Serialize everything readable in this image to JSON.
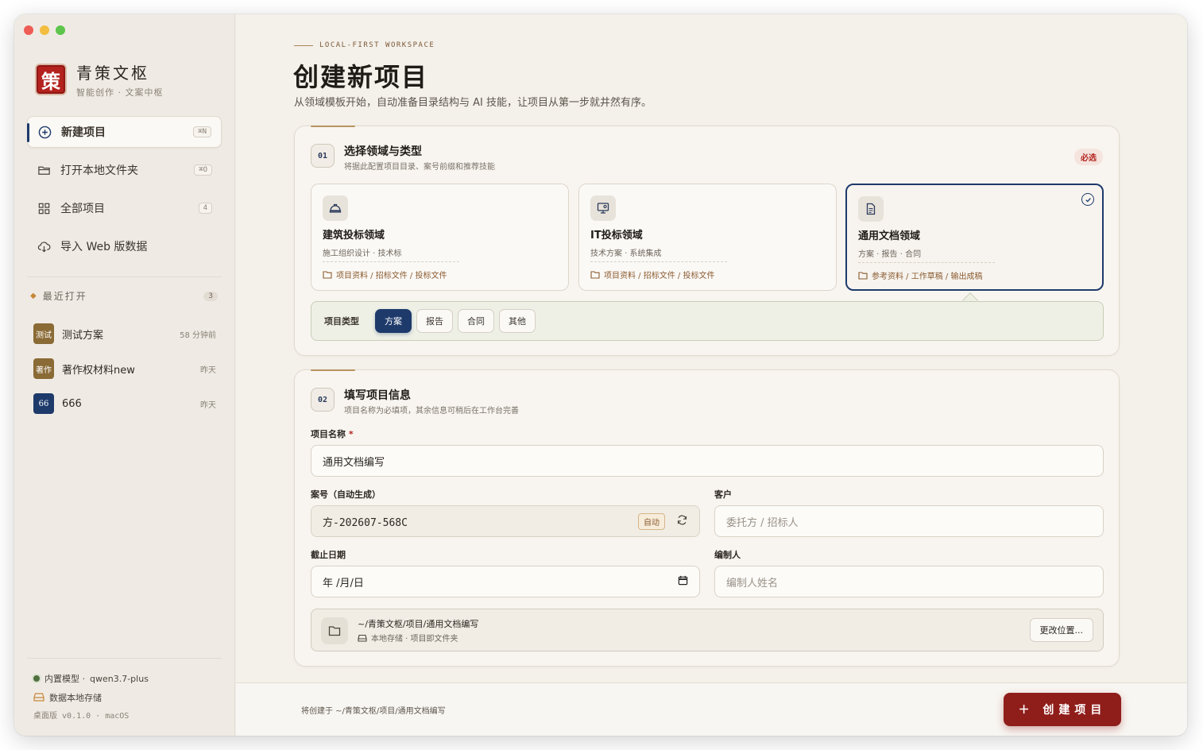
{
  "brand": {
    "seal_char": "策",
    "title": "青策文枢",
    "subtitle": "智能创作 · 文案中枢"
  },
  "nav": [
    {
      "label": "新建项目",
      "shortcut": "⌘N",
      "active": true
    },
    {
      "label": "打开本地文件夹",
      "shortcut": "⌘O"
    },
    {
      "label": "全部项目",
      "count": "4"
    },
    {
      "label": "导入 Web 版数据"
    }
  ],
  "recent": {
    "heading": "最近打开",
    "count": "3",
    "items": [
      {
        "badge": "测试",
        "name": "测试方案",
        "time": "58 分钟前",
        "color": "#8a6a35"
      },
      {
        "badge": "著作",
        "name": "著作权材料new",
        "time": "昨天",
        "color": "#8a6a35"
      },
      {
        "badge": "66",
        "name": "666",
        "time": "昨天",
        "color": "#1e3a6b"
      }
    ]
  },
  "footer": {
    "model_label": "内置模型 ·",
    "model_name": "qwen3.7-plus",
    "storage": "数据本地存储",
    "version": "桌面版 v0.1.0 · macOS"
  },
  "header": {
    "eyebrow": "LOCAL-FIRST WORKSPACE",
    "title": "创建新项目",
    "subtitle": "从领域模板开始，自动准备目录结构与 AI 技能，让项目从第一步就井然有序。"
  },
  "step1": {
    "num": "01",
    "title": "选择领域与类型",
    "desc": "将据此配置项目目录、案号前缀和推荐技能",
    "required": "必选",
    "domains": [
      {
        "name": "建筑投标领域",
        "tags": "施工组织设计 · 技术标",
        "folders": "项目资料 / 招标文件 / 投标文件",
        "icon": "helmet-icon"
      },
      {
        "name": "IT投标领域",
        "tags": "技术方案 · 系统集成",
        "folders": "项目资料 / 招标文件 / 投标文件",
        "icon": "monitor-icon"
      },
      {
        "name": "通用文档领域",
        "tags": "方案 · 报告 · 合同",
        "folders": "参考资料 / 工作草稿 / 输出成稿",
        "icon": "document-icon",
        "selected": true
      }
    ],
    "type_label": "项目类型",
    "types": [
      "方案",
      "报告",
      "合同",
      "其他"
    ],
    "selected_type": "方案"
  },
  "step2": {
    "num": "02",
    "title": "填写项目信息",
    "desc": "项目名称为必填项，其余信息可稍后在工作台完善",
    "name_label": "项目名称",
    "name_required": "*",
    "name_value": "通用文档编写",
    "code_label": "案号（自动生成）",
    "code_value": "方-202607-568C",
    "code_badge": "自动",
    "client_label": "客户",
    "client_placeholder": "委托方 / 招标人",
    "deadline_label": "截止日期",
    "deadline_value": "年 /月/日",
    "author_label": "编制人",
    "author_placeholder": "编制人姓名",
    "location_path": "~/青策文枢/项目/通用文档编写",
    "location_sub": "本地存储 · 项目即文件夹",
    "location_btn": "更改位置..."
  },
  "bottom": {
    "will_create": "将创建于 ~/青策文枢/项目/通用文档编写",
    "create_btn": "＋ 创建项目"
  },
  "colors": {
    "accent_navy": "#1e3a6b",
    "brand_red": "#b3221e",
    "create_btn": "#8f1d1a"
  }
}
